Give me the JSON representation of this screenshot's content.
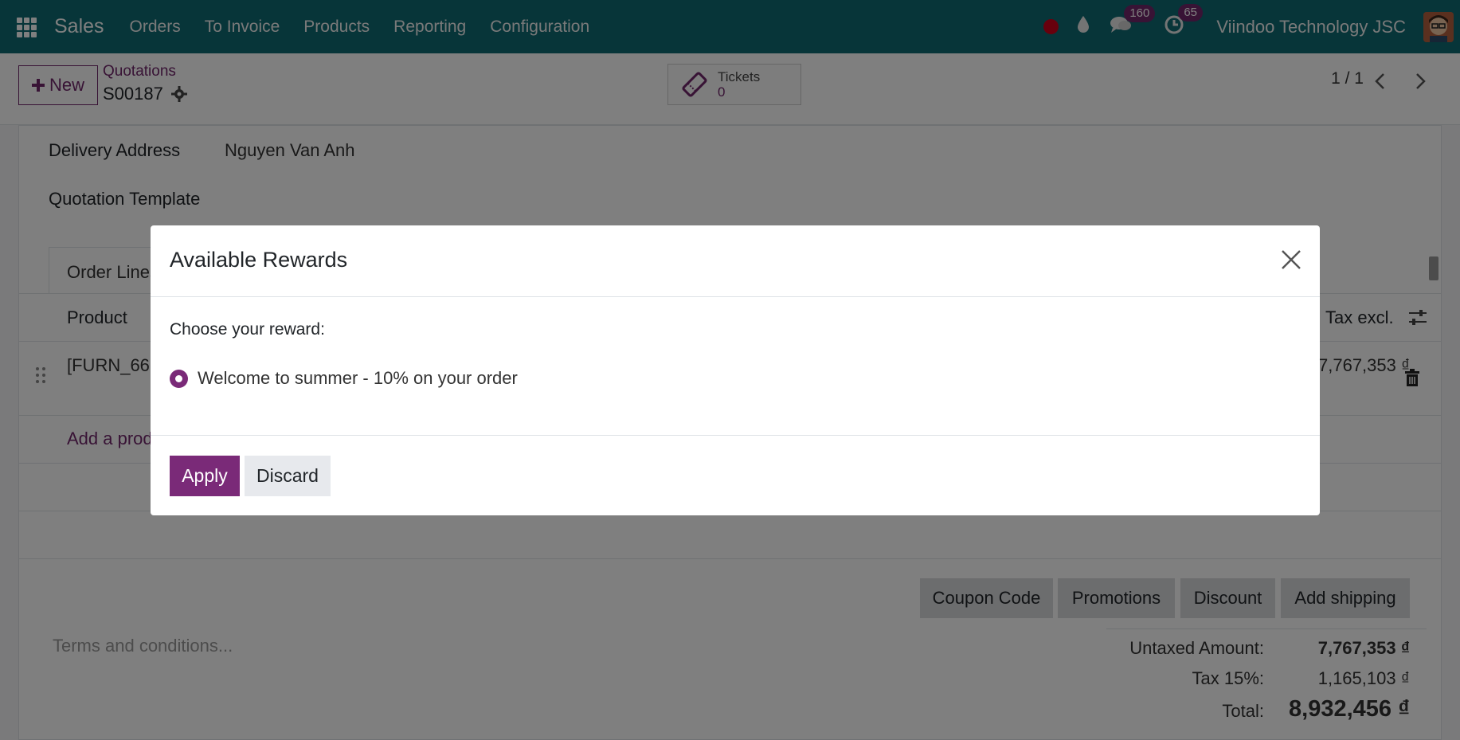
{
  "navbar": {
    "app_name": "Sales",
    "menu": [
      "Orders",
      "To Invoice",
      "Products",
      "Reporting",
      "Configuration"
    ],
    "messages_count": "160",
    "activities_count": "65",
    "company": "Viindoo Technology JSC",
    "accent_color": "#0f6b73"
  },
  "control_panel": {
    "new_label": "New",
    "breadcrumb": "Quotations",
    "record_name": "S00187",
    "tickets_label": "Tickets",
    "tickets_count": "0",
    "pager": "1 / 1"
  },
  "form": {
    "delivery_address_label": "Delivery Address",
    "delivery_address_value": "Nguyen Van Anh",
    "quotation_template_label": "Quotation Template",
    "tab_order_lines": "Order Lines",
    "col_product": "Product",
    "col_tax_excl": "Tax excl.",
    "line_product": "[FURN_666",
    "line_amount": "7,767,353 ₫",
    "add_product": "Add a product",
    "buttons": [
      "Coupon Code",
      "Promotions",
      "Discount",
      "Add shipping"
    ],
    "terms_placeholder": "Terms and conditions...",
    "untaxed_label": "Untaxed Amount:",
    "untaxed_value": "7,767,353 ₫",
    "tax_label": "Tax 15%:",
    "tax_value": "1,165,103 ₫",
    "total_label": "Total:",
    "total_value": "8,932,456 ₫"
  },
  "modal": {
    "title": "Available Rewards",
    "choose_label": "Choose your reward:",
    "reward_option": "Welcome to summer - 10% on your order",
    "apply_label": "Apply",
    "discard_label": "Discard",
    "primary_color": "#7a2a78"
  }
}
